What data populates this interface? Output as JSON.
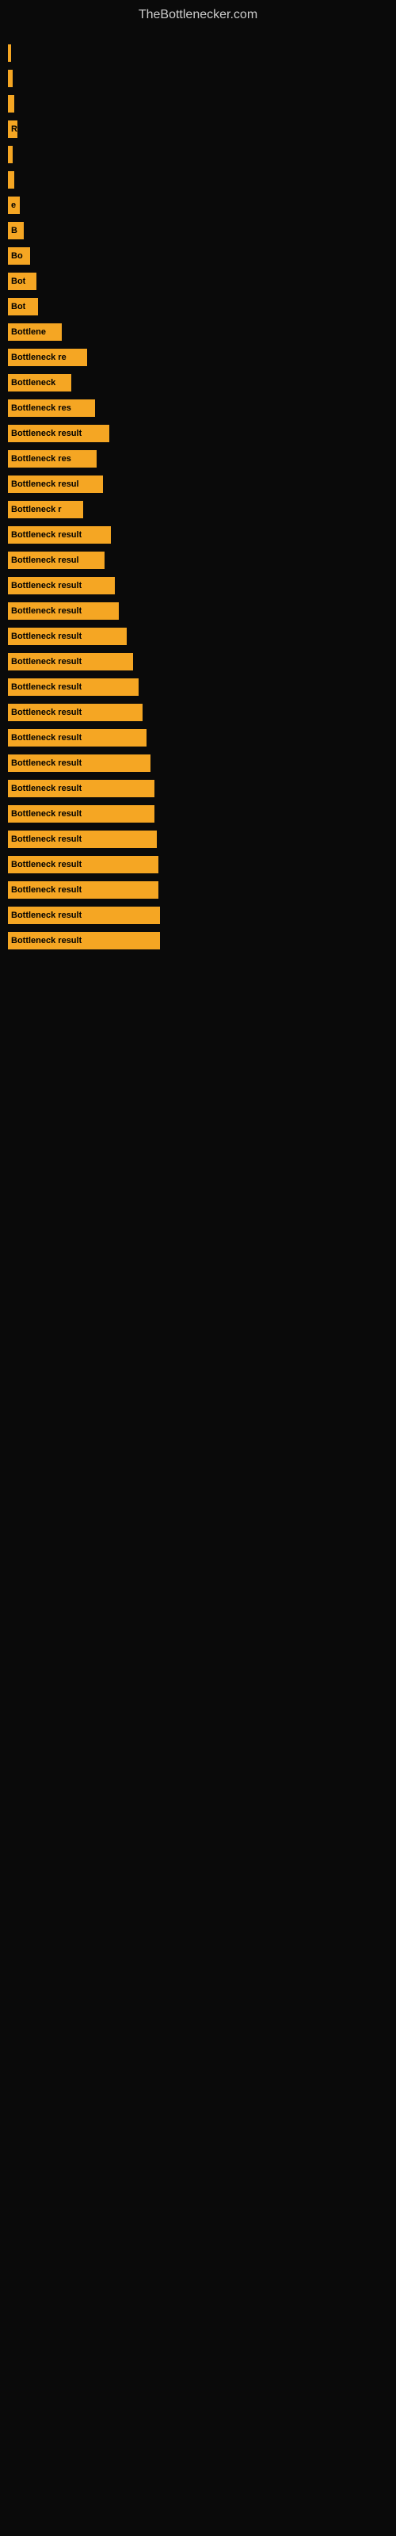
{
  "site": {
    "title": "TheBottlenecker.com"
  },
  "bars": [
    {
      "label": "",
      "width": 4
    },
    {
      "label": "",
      "width": 6
    },
    {
      "label": "",
      "width": 8
    },
    {
      "label": "R",
      "width": 12
    },
    {
      "label": "",
      "width": 6
    },
    {
      "label": "",
      "width": 8
    },
    {
      "label": "e",
      "width": 15
    },
    {
      "label": "B",
      "width": 20
    },
    {
      "label": "Bo",
      "width": 28
    },
    {
      "label": "Bot",
      "width": 36
    },
    {
      "label": "Bot",
      "width": 38
    },
    {
      "label": "Bottlene",
      "width": 68
    },
    {
      "label": "Bottleneck re",
      "width": 100
    },
    {
      "label": "Bottleneck",
      "width": 80
    },
    {
      "label": "Bottleneck res",
      "width": 110
    },
    {
      "label": "Bottleneck result",
      "width": 128
    },
    {
      "label": "Bottleneck res",
      "width": 112
    },
    {
      "label": "Bottleneck resul",
      "width": 120
    },
    {
      "label": "Bottleneck r",
      "width": 95
    },
    {
      "label": "Bottleneck result",
      "width": 130
    },
    {
      "label": "Bottleneck resul",
      "width": 122
    },
    {
      "label": "Bottleneck result",
      "width": 135
    },
    {
      "label": "Bottleneck result",
      "width": 140
    },
    {
      "label": "Bottleneck result",
      "width": 150
    },
    {
      "label": "Bottleneck result",
      "width": 158
    },
    {
      "label": "Bottleneck result",
      "width": 165
    },
    {
      "label": "Bottleneck result",
      "width": 170
    },
    {
      "label": "Bottleneck result",
      "width": 175
    },
    {
      "label": "Bottleneck result",
      "width": 180
    },
    {
      "label": "Bottleneck result",
      "width": 185
    },
    {
      "label": "Bottleneck result",
      "width": 185
    },
    {
      "label": "Bottleneck result",
      "width": 188
    },
    {
      "label": "Bottleneck result",
      "width": 190
    },
    {
      "label": "Bottleneck result",
      "width": 190
    },
    {
      "label": "Bottleneck result",
      "width": 192
    },
    {
      "label": "Bottleneck result",
      "width": 192
    }
  ]
}
